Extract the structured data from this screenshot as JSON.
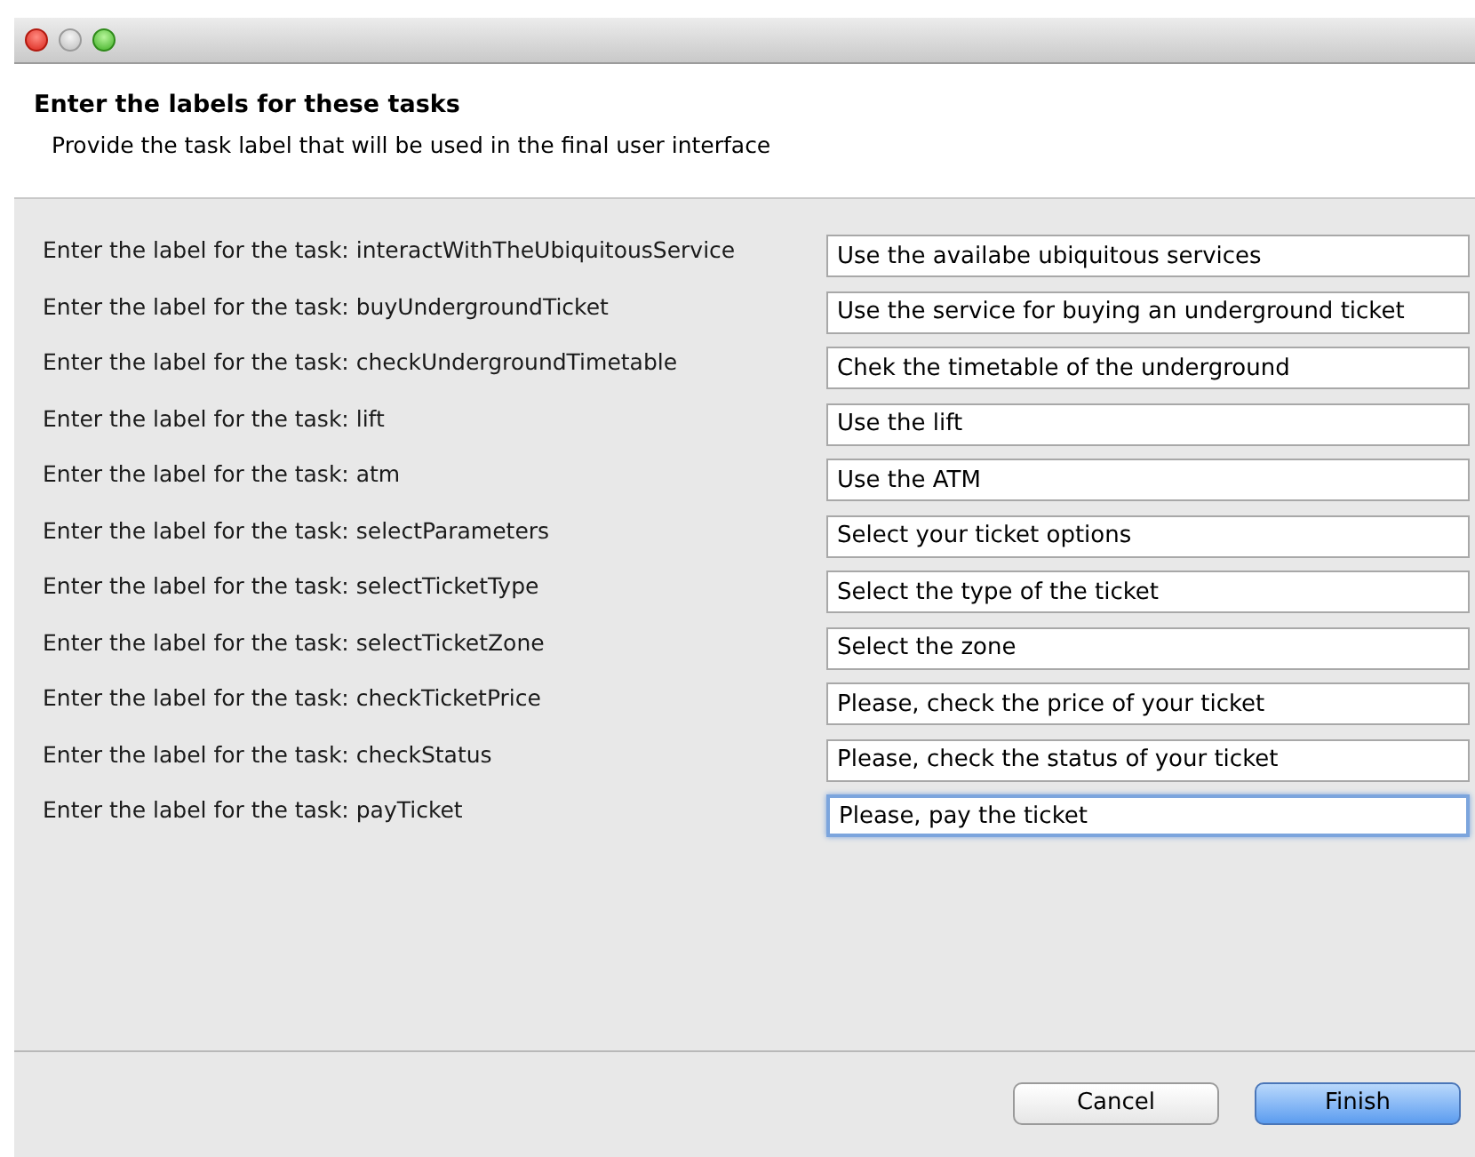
{
  "window": {
    "title_bar": {
      "buttons": [
        {
          "kind": "close"
        },
        {
          "kind": "minimize"
        },
        {
          "kind": "zoom"
        }
      ]
    }
  },
  "header": {
    "title": "Enter the labels for these tasks",
    "description": "Provide the task label that will be used in the final user interface"
  },
  "rows": [
    {
      "label": "Enter the label for the task: interactWithTheUbiquitousService",
      "value": "Use the availabe ubiquitous services",
      "focused": false
    },
    {
      "label": "Enter the label for the task: buyUndergroundTicket",
      "value": "Use the service for buying an underground ticket",
      "focused": false
    },
    {
      "label": "Enter the label for the task: checkUndergroundTimetable",
      "value": "Chek the timetable of the underground",
      "focused": false
    },
    {
      "label": "Enter the label for the task: lift",
      "value": "Use the lift",
      "focused": false
    },
    {
      "label": "Enter the label for the task: atm",
      "value": "Use the ATM",
      "focused": false
    },
    {
      "label": "Enter the label for the task: selectParameters",
      "value": "Select your ticket options",
      "focused": false
    },
    {
      "label": "Enter the label for the task: selectTicketType",
      "value": "Select the type of the ticket",
      "focused": false
    },
    {
      "label": "Enter the label for the task: selectTicketZone",
      "value": "Select the zone",
      "focused": false
    },
    {
      "label": "Enter the label for the task: checkTicketPrice",
      "value": "Please, check the price of your ticket",
      "focused": false
    },
    {
      "label": "Enter the label for the task: checkStatus",
      "value": "Please, check the status of your ticket",
      "focused": false
    },
    {
      "label": "Enter the label for the task: payTicket",
      "value": "Please, pay the ticket",
      "focused": true
    }
  ],
  "buttons": [
    {
      "label": "Cancel",
      "default": false
    },
    {
      "label": "Finish",
      "default": true
    }
  ]
}
